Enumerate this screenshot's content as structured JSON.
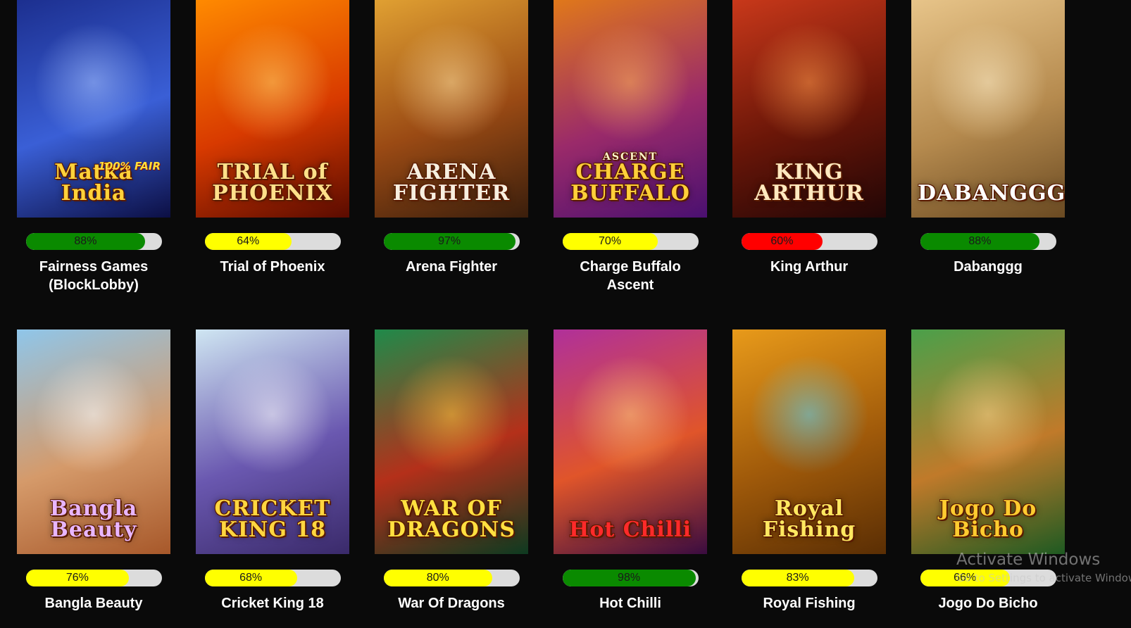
{
  "games": [
    {
      "name": "Fairness Games (BlockLobby)",
      "logo": "Matka India",
      "tag": "100% FAIR",
      "percent": 88,
      "percent_label": "88%",
      "bar_color": "#0a8a00",
      "art": [
        "#1c2f8f",
        "#3a5fd6",
        "#0c0f44"
      ],
      "glow": "#a9c4ff",
      "logo_color": "#ffd23a"
    },
    {
      "name": "Trial of Phoenix",
      "logo": "TRIAL of PHOENIX",
      "percent": 64,
      "percent_label": "64%",
      "bar_color": "#ffff00",
      "art": [
        "#ff8a00",
        "#d83a00",
        "#5a0b00"
      ],
      "glow": "#ffd36a",
      "logo_color": "#ffe08a"
    },
    {
      "name": "Arena Fighter",
      "logo": "ARENA FIGHTER",
      "percent": 97,
      "percent_label": "97%",
      "bar_color": "#0a8a00",
      "art": [
        "#e0a032",
        "#9a4a14",
        "#3a1e0c"
      ],
      "glow": "#ffe0a0",
      "logo_color": "#f7efe0"
    },
    {
      "name": "Charge Buffalo Ascent",
      "logo": "CHARGE BUFFALO",
      "logo_pre": "ASCENT",
      "percent": 70,
      "percent_label": "70%",
      "bar_color": "#ffff00",
      "art": [
        "#e0781a",
        "#9a2a6a",
        "#4a1070"
      ],
      "glow": "#ffb45a",
      "logo_color": "#ffcf3a"
    },
    {
      "name": "King Arthur",
      "logo": "KING ARTHUR",
      "percent": 60,
      "percent_label": "60%",
      "bar_color": "#ff0000",
      "art": [
        "#c8381a",
        "#6a1608",
        "#220606"
      ],
      "glow": "#ff9a4a",
      "logo_color": "#ffe9c0"
    },
    {
      "name": "Dabanggg",
      "logo": "DABANGGG",
      "percent": 88,
      "percent_label": "88%",
      "bar_color": "#0a8a00",
      "art": [
        "#e7c489",
        "#b58a4e",
        "#6a4a22"
      ],
      "glow": "#fff0cc",
      "logo_color": "#ffffff"
    },
    {
      "name": "Bangla Beauty",
      "logo": "Bangla Beauty",
      "percent": 76,
      "percent_label": "76%",
      "bar_color": "#ffff00",
      "art": [
        "#8fc6ea",
        "#d59a6a",
        "#a7582a"
      ],
      "glow": "#ffffff",
      "logo_color": "#e8b6ff"
    },
    {
      "name": "Cricket King 18",
      "logo": "CRICKET KING 18",
      "percent": 68,
      "percent_label": "68%",
      "bar_color": "#ffff00",
      "art": [
        "#cfe6f2",
        "#6a58b0",
        "#3a2a6a"
      ],
      "glow": "#ffffff",
      "logo_color": "#ffd640"
    },
    {
      "name": "War Of Dragons",
      "logo": "WAR OF DRAGONS",
      "percent": 80,
      "percent_label": "80%",
      "bar_color": "#ffff00",
      "art": [
        "#1f8a4a",
        "#b4301a",
        "#0d3a20"
      ],
      "glow": "#ffcc40",
      "logo_color": "#ffe040"
    },
    {
      "name": "Hot Chilli",
      "logo": "Hot Chilli",
      "percent": 98,
      "percent_label": "98%",
      "bar_color": "#0a8a00",
      "art": [
        "#b0309a",
        "#e0552a",
        "#3a0c40"
      ],
      "glow": "#ffd080",
      "logo_color": "#ff2a2a"
    },
    {
      "name": "Royal Fishing",
      "logo": "Royal Fishing",
      "percent": 83,
      "percent_label": "83%",
      "bar_color": "#ffff00",
      "art": [
        "#e89a1a",
        "#a05a0a",
        "#5a2e04"
      ],
      "glow": "#5ad6ff",
      "logo_color": "#ffe860"
    },
    {
      "name": "Jogo Do Bicho",
      "logo": "Jogo Do Bicho",
      "percent": 66,
      "percent_label": "66%",
      "bar_color": "#ffff00",
      "art": [
        "#4aa04a",
        "#c07a2a",
        "#1e5a22"
      ],
      "glow": "#ffd890",
      "logo_color": "#ffcc30"
    }
  ],
  "watermark": {
    "title": "Activate Windows",
    "subtitle": "Go to Settings to activate Windows."
  }
}
